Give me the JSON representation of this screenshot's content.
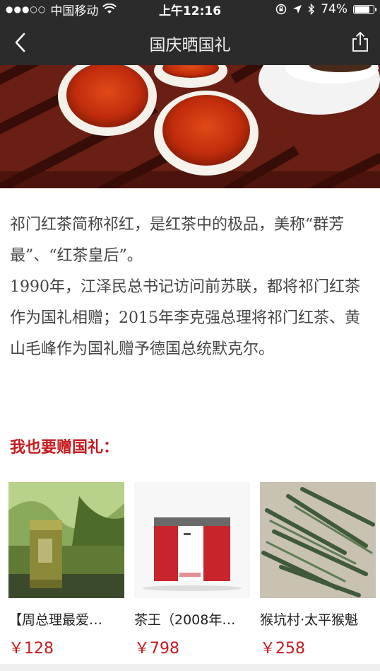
{
  "status_bar": {
    "signal": "●●●○○",
    "carrier": "中国移动",
    "time": "上午12:16",
    "battery": "74%",
    "battery_level": 0.74
  },
  "nav": {
    "title": "国庆晒国礼",
    "back_icon": "chevron-left-icon",
    "share_icon": "share-icon"
  },
  "article": {
    "paragraph1": "祁门红茶简称祁红，是红茶中的极品，美称“群芳最”、“红茶皇后”。",
    "paragraph2": "1990年，江泽民总书记访问前苏联，都将祁门红茶作为国礼相赠；2015年李克强总理将祁门红茶、黄山毛峰作为国礼赠予德国总统默克尔。"
  },
  "section": {
    "title": "我也要赠国礼："
  },
  "products": [
    {
      "name": "【周总理最爱…",
      "price": "￥128"
    },
    {
      "name": "茶王（2008年…",
      "price": "￥798"
    },
    {
      "name": "猴坑村·太平猴魁",
      "price": "￥258"
    }
  ]
}
